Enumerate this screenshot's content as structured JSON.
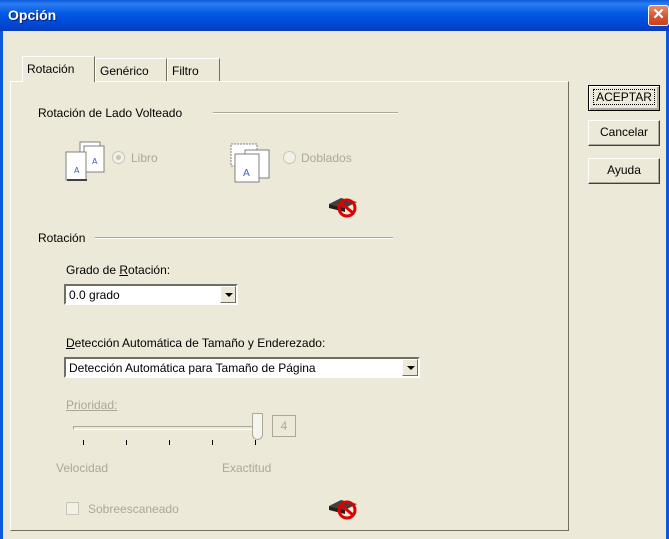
{
  "window": {
    "title": "Opción",
    "close_glyph": "✕"
  },
  "tabs": [
    {
      "label": "Rotación",
      "active": true
    },
    {
      "label": "Genérico",
      "active": false
    },
    {
      "label": "Filtro",
      "active": false
    }
  ],
  "flip_group": {
    "title": "Rotación de Lado Volteado",
    "options": [
      {
        "label": "Libro",
        "selected": true,
        "enabled": false,
        "icon": "book-pages-icon"
      },
      {
        "label": "Doblados",
        "selected": false,
        "enabled": false,
        "icon": "folded-pages-icon"
      }
    ],
    "status_icon": "scanner-not-available-icon"
  },
  "rotation_group": {
    "title": "Rotación",
    "degree_label_pre": "Grado de ",
    "degree_label_accel": "R",
    "degree_label_post": "otación:",
    "degree_value": "0.0 grado",
    "auto_label_accel": "D",
    "auto_label_post": "etección Automática de Tamaño y Enderezado:",
    "auto_value": "Detección Automática para Tamaño de Página",
    "priority_label": "Prioridad:",
    "priority_value": "4",
    "priority_level_fraction": 1.0,
    "speed_label": "Velocidad",
    "accuracy_label": "Exactitud",
    "overscan_label": "Sobreescaneado",
    "overscan_checked": false,
    "status_icon": "scanner-not-available-icon"
  },
  "buttons": {
    "ok": "ACEPTAR",
    "cancel": "Cancelar",
    "help": "Ayuda"
  },
  "colors": {
    "titlebar": "#0058E4",
    "close": "#D4522D",
    "face": "#ECE9D8",
    "disabled_text": "#ACA899"
  }
}
